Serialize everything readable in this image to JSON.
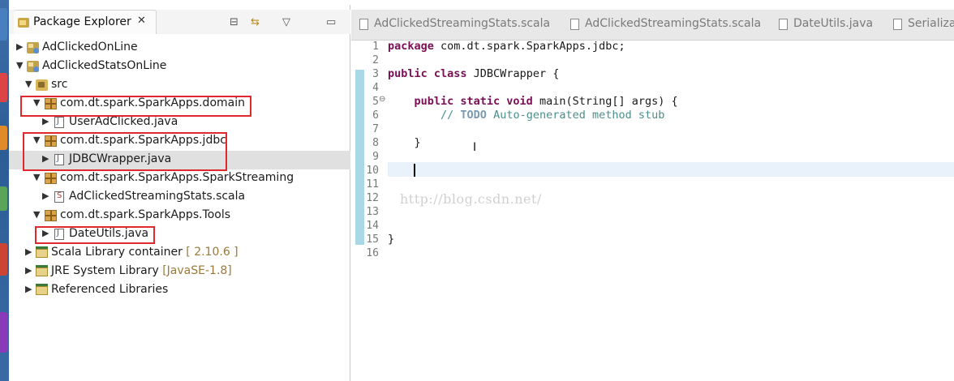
{
  "explorer": {
    "title": "Package Explorer",
    "close": "✕",
    "toolbar": {
      "collapse": "⊟",
      "link": "⇆",
      "menu": "▽",
      "minimize": "▭"
    },
    "items": [
      {
        "label": "AdClickedOnLine",
        "decoration": "",
        "twisty": "▶",
        "icon": "project"
      },
      {
        "label": "AdClickedStatsOnLine",
        "decoration": "",
        "twisty": "▼",
        "icon": "project"
      },
      {
        "label": "src",
        "decoration": "",
        "twisty": "▼",
        "icon": "source-folder"
      },
      {
        "label": "com.dt.spark.SparkApps.domain",
        "decoration": "",
        "twisty": "▼",
        "icon": "package"
      },
      {
        "label": "UserAdClicked.java",
        "decoration": "",
        "twisty": "▶",
        "icon": "java-file"
      },
      {
        "label": "com.dt.spark.SparkApps.jdbc",
        "decoration": "",
        "twisty": "▼",
        "icon": "package"
      },
      {
        "label": "JDBCWrapper.java",
        "decoration": "",
        "twisty": "▶",
        "icon": "java-file"
      },
      {
        "label": "com.dt.spark.SparkApps.SparkStreaming",
        "decoration": "",
        "twisty": "▼",
        "icon": "package"
      },
      {
        "label": "AdClickedStreamingStats.scala",
        "decoration": "",
        "twisty": "▶",
        "icon": "scala-file"
      },
      {
        "label": "com.dt.spark.SparkApps.Tools",
        "decoration": "",
        "twisty": "▼",
        "icon": "package"
      },
      {
        "label": "DateUtils.java",
        "decoration": "",
        "twisty": "▶",
        "icon": "java-file"
      },
      {
        "label": "Scala Library container",
        "decoration": " [ 2.10.6 ]",
        "twisty": "▶",
        "icon": "library"
      },
      {
        "label": "JRE System Library",
        "decoration": " [JavaSE-1.8]",
        "twisty": "▶",
        "icon": "library"
      },
      {
        "label": "Referenced Libraries",
        "decoration": "",
        "twisty": "▶",
        "icon": "library"
      }
    ]
  },
  "editor": {
    "tabs": [
      {
        "label": "AdClickedStreamingStats.scala"
      },
      {
        "label": "AdClickedStreamingStats.scala"
      },
      {
        "label": "DateUtils.java"
      },
      {
        "label": "Serializa"
      }
    ],
    "line_numbers": [
      "1",
      "2",
      "3",
      "4",
      "5",
      "6",
      "7",
      "8",
      "9",
      "10",
      "11",
      "12",
      "13",
      "14",
      "15",
      "16"
    ],
    "fold_marker": "⊖",
    "code": {
      "l1_kw": "package",
      "l1_rest": " com.dt.spark.SparkApps.jdbc;",
      "l3_kw": "public class",
      "l3_rest": " JDBCWrapper {",
      "l5_indent": "    ",
      "l5_kw": "public static void",
      "l5_rest": " main(String[] args) {",
      "l6_indent": "        ",
      "l6_cm1": "// ",
      "l6_todo": "TODO",
      "l6_cm2": " Auto-generated method stub",
      "l8": "    }",
      "l15": "}"
    },
    "watermark": "http://blog.csdn.net/"
  }
}
